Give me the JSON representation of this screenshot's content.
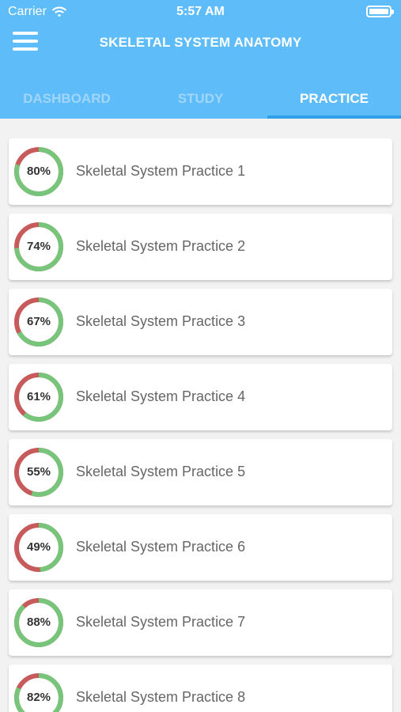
{
  "status": {
    "carrier": "Carrier",
    "time": "5:57 AM"
  },
  "nav": {
    "title": "SKELETAL SYSTEM ANATOMY"
  },
  "tabs": [
    {
      "label": "DASHBOARD",
      "active": false
    },
    {
      "label": "STUDY",
      "active": false
    },
    {
      "label": "PRACTICE",
      "active": true
    }
  ],
  "colors": {
    "header": "#5ebcf8",
    "correct": "#77c57a",
    "incorrect": "#c75a5a"
  },
  "practices": [
    {
      "title": "Skeletal System Practice 1",
      "percent_label": "80%",
      "percent": 80
    },
    {
      "title": "Skeletal System Practice 2",
      "percent_label": "74%",
      "percent": 74
    },
    {
      "title": "Skeletal System Practice 3",
      "percent_label": "67%",
      "percent": 67
    },
    {
      "title": "Skeletal System Practice 4",
      "percent_label": "61%",
      "percent": 61
    },
    {
      "title": "Skeletal System Practice 5",
      "percent_label": "55%",
      "percent": 55
    },
    {
      "title": "Skeletal System Practice 6",
      "percent_label": "49%",
      "percent": 49
    },
    {
      "title": "Skeletal System Practice 7",
      "percent_label": "88%",
      "percent": 88
    },
    {
      "title": "Skeletal System Practice 8",
      "percent_label": "82%",
      "percent": 82
    }
  ]
}
